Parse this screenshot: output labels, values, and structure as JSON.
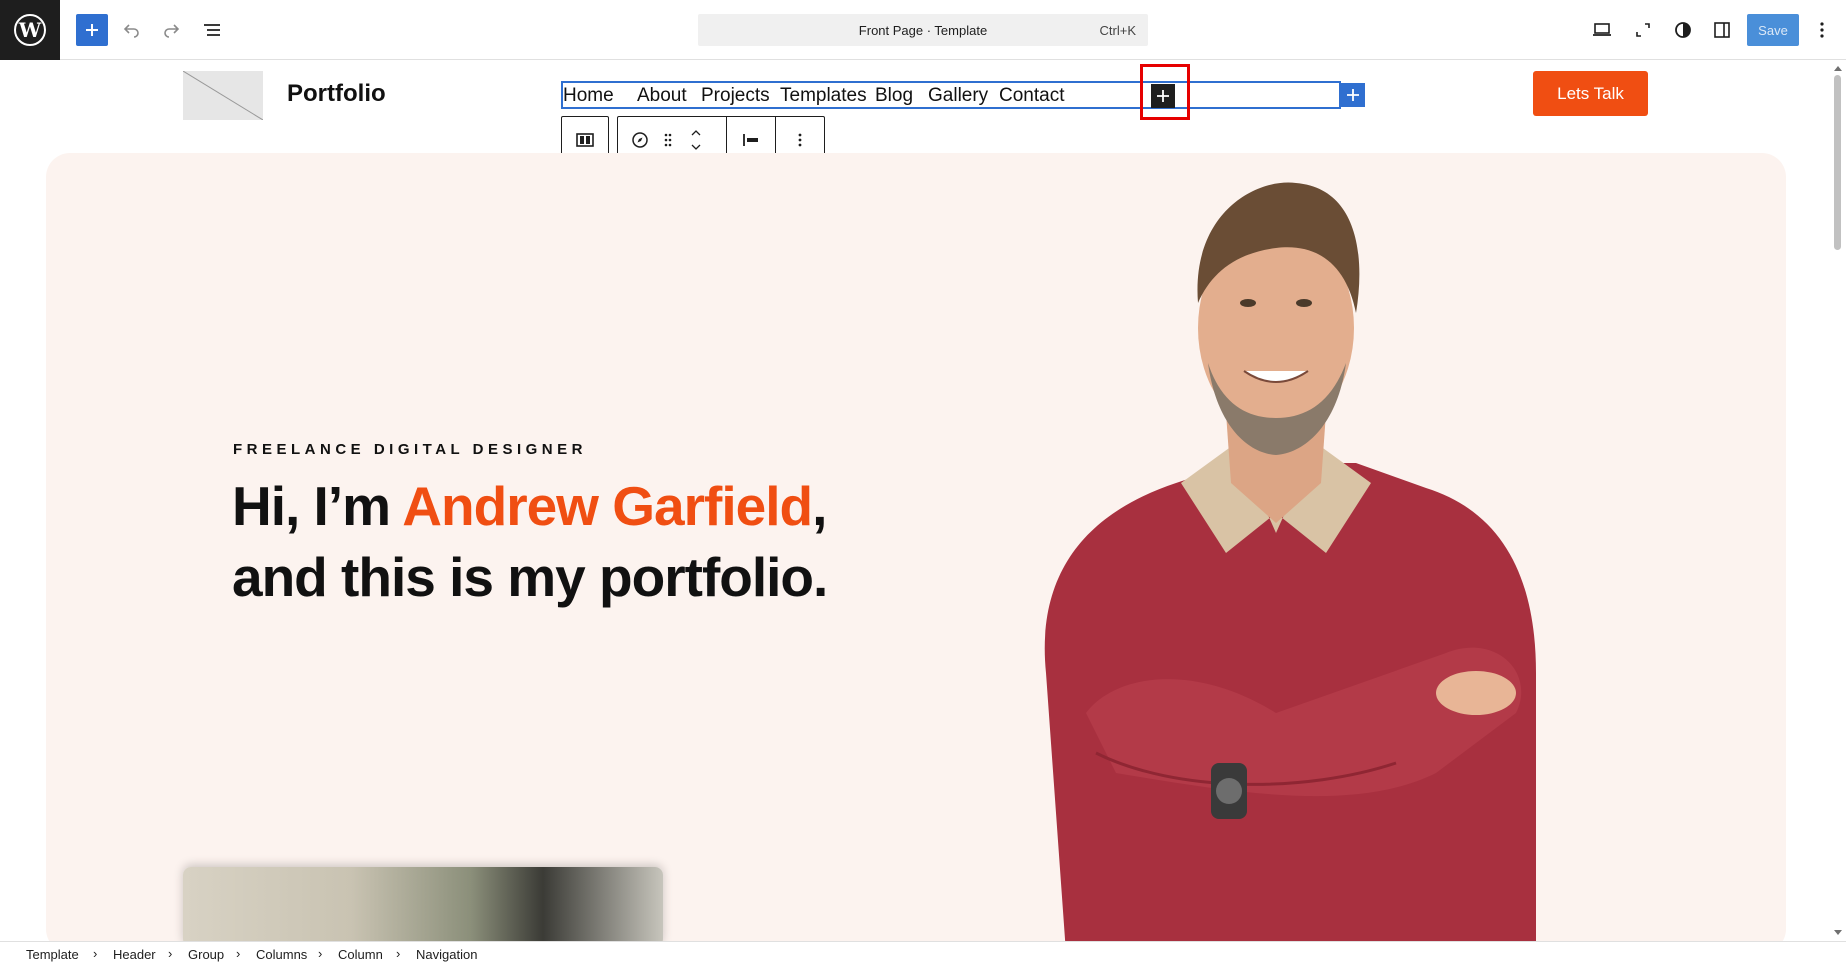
{
  "toolbar": {
    "command_title": "Front Page · Template",
    "command_shortcut": "Ctrl+K",
    "save_label": "Save",
    "accent": "#2f6fd0"
  },
  "site": {
    "title": "Portfolio",
    "nav": [
      "Home",
      "About",
      "Projects",
      "Templates",
      "Blog",
      "Gallery",
      "Contact"
    ],
    "cta": "Lets Talk",
    "accent": "#f04e12"
  },
  "hero": {
    "eyebrow": "FREELANCE DIGITAL DESIGNER",
    "headline_1": "Hi, I’m ",
    "headline_name": "Andrew Garfield",
    "headline_2": ", and this is my portfolio.",
    "background": "#fcf3ef"
  },
  "breadcrumb": [
    "Template",
    "Header",
    "Group",
    "Columns",
    "Column",
    "Navigation"
  ]
}
